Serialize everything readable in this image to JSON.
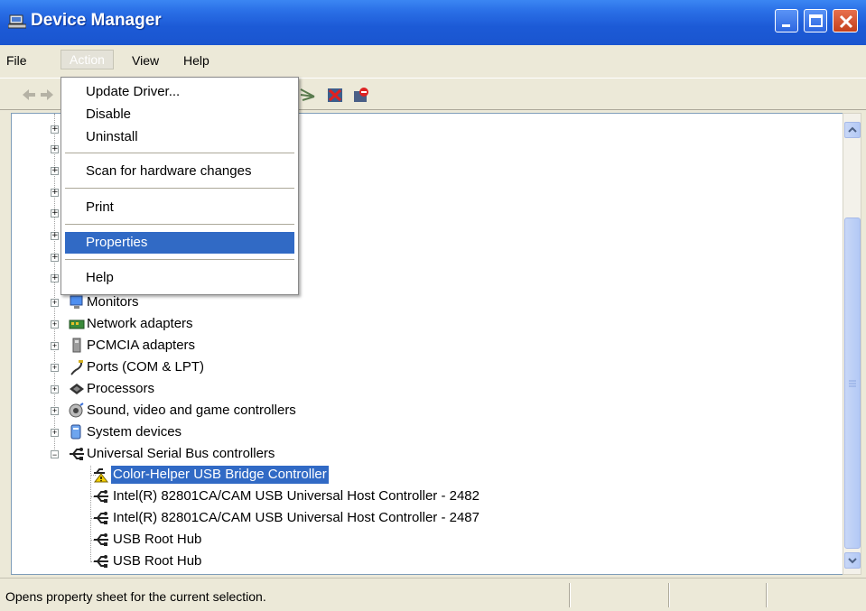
{
  "window": {
    "title": "Device Manager"
  },
  "menubar": {
    "items": [
      "File",
      "Action",
      "View",
      "Help"
    ]
  },
  "toolbar": {
    "icons": [
      "back-arrow-icon",
      "forward-arrow-icon",
      "scan-hardware-icon",
      "uninstall-icon",
      "disable-icon"
    ]
  },
  "action_menu": {
    "items": [
      "Update Driver...",
      "Disable",
      "Uninstall",
      "Scan for hardware changes",
      "Print",
      "Properties",
      "Help"
    ],
    "highlighted": "Properties"
  },
  "tree": {
    "categories": [
      {
        "label": "Monitors",
        "icon": "monitor-icon"
      },
      {
        "label": "Network adapters",
        "icon": "network-adapter-icon"
      },
      {
        "label": "PCMCIA adapters",
        "icon": "pcmcia-icon"
      },
      {
        "label": "Ports (COM & LPT)",
        "icon": "port-icon"
      },
      {
        "label": "Processors",
        "icon": "processor-icon"
      },
      {
        "label": "Sound, video and game controllers",
        "icon": "sound-icon"
      },
      {
        "label": "System devices",
        "icon": "system-device-icon"
      },
      {
        "label": "Universal Serial Bus controllers",
        "icon": "usb-icon"
      }
    ],
    "usb_children": [
      {
        "label": "Color-Helper USB Bridge Controller",
        "icon": "usb-warning-icon",
        "selected": true
      },
      {
        "label": "Intel(R) 82801CA/CAM USB Universal Host Controller - 2482",
        "icon": "usb-icon"
      },
      {
        "label": "Intel(R) 82801CA/CAM USB Universal Host Controller - 2487",
        "icon": "usb-icon"
      },
      {
        "label": "USB Root Hub",
        "icon": "usb-icon"
      },
      {
        "label": "USB Root Hub",
        "icon": "usb-icon"
      }
    ]
  },
  "statusbar": {
    "text": "Opens property sheet for the current selection."
  },
  "colors": {
    "titlebar": "#1c5ad6",
    "selection": "#316ac5",
    "chrome": "#ece9d8"
  }
}
